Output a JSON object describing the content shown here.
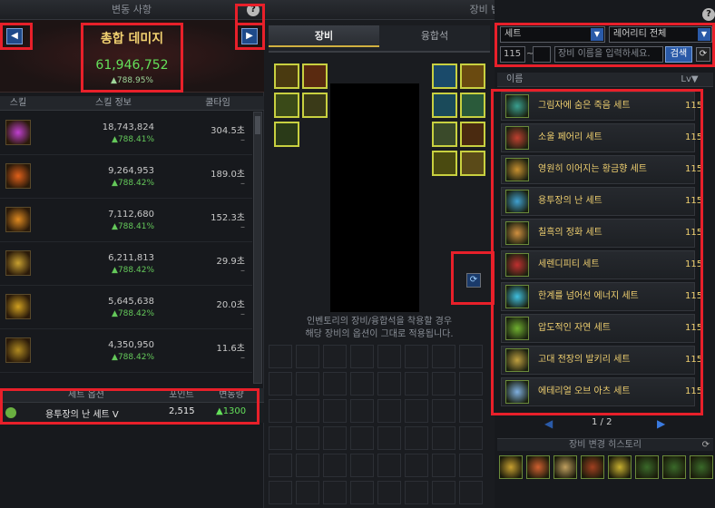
{
  "left_panel": {
    "title": "변동 사항",
    "prev_icon": "left-arrow-icon",
    "next_icon": "right-arrow-icon",
    "help_icon": "?",
    "total_damage": {
      "label": "총합 데미지",
      "value": "61,946,752",
      "change": "▲788.95%"
    },
    "columns": {
      "skill": "스킬",
      "info": "스킬 정보",
      "cooldown": "쿨타임"
    },
    "skills": [
      {
        "icon": "magic-burst-skill-icon",
        "color": "#c040d0",
        "value": "18,743,824",
        "change": "▲788.41%",
        "cooldown": "304.5초",
        "extra": "–"
      },
      {
        "icon": "atom-skill-icon",
        "color": "#e0601a",
        "value": "9,264,953",
        "change": "▲788.42%",
        "cooldown": "189.0초",
        "extra": "–"
      },
      {
        "icon": "fire-pillar-skill-icon",
        "color": "#e08a20",
        "value": "7,112,680",
        "change": "▲788.41%",
        "cooldown": "152.3초",
        "extra": "–"
      },
      {
        "icon": "golden-chest-skill-icon",
        "color": "#c8a030",
        "value": "6,211,813",
        "change": "▲788.42%",
        "cooldown": "29.9초",
        "extra": "–"
      },
      {
        "icon": "golden-bell-skill-icon",
        "color": "#d0a020",
        "value": "5,645,638",
        "change": "▲788.42%",
        "cooldown": "20.0초",
        "extra": "–"
      },
      {
        "icon": "golden-cannon-skill-icon",
        "color": "#b08a20",
        "value": "4,350,950",
        "change": "▲788.42%",
        "cooldown": "11.6초",
        "extra": "–"
      }
    ],
    "set_columns": {
      "name": "세트 옵션",
      "points": "포인트",
      "change": "변동량"
    },
    "set_option": {
      "name": "용투장의 난 세트 V",
      "points": "2,515",
      "change": "▲1300"
    }
  },
  "mid_panel": {
    "title": "장비 변경",
    "tabs": [
      "장비",
      "융합석"
    ],
    "notice_line1": "인벤토리의 장비/융합석을 착용할 경우",
    "notice_line2": "해당 장비의 옵션이 그대로 적용됩니다."
  },
  "right_panel": {
    "help_icon": "?",
    "filter_type": "세트",
    "filter_rarity": "레어리티 전체",
    "level_min": "115",
    "level_sep": "~",
    "search_placeholder": "장비 이름을 입력하세요.",
    "search_button": "검색",
    "columns": {
      "name": "이름",
      "level": "Lv▼"
    },
    "sets": [
      {
        "name": "그림자에 숨은 죽음 세트",
        "lv": "115",
        "color": "#3aa090"
      },
      {
        "name": "소울 페어리 세트",
        "lv": "115",
        "color": "#c04030"
      },
      {
        "name": "영원히 이어지는 황금향 세트",
        "lv": "115",
        "color": "#c89030"
      },
      {
        "name": "용투장의 난 세트",
        "lv": "115",
        "color": "#40a0d0"
      },
      {
        "name": "칠흑의 정화 세트",
        "lv": "115",
        "color": "#d09040"
      },
      {
        "name": "세렌디피티 세트",
        "lv": "115",
        "color": "#c03030"
      },
      {
        "name": "한계를 넘어선 에너지 세트",
        "lv": "115",
        "color": "#40c0e0"
      },
      {
        "name": "압도적인 자연 세트",
        "lv": "115",
        "color": "#70b030"
      },
      {
        "name": "고대 전장의 발키리 세트",
        "lv": "115",
        "color": "#c0a040"
      },
      {
        "name": "에테리얼 오브 아츠 세트",
        "lv": "115",
        "color": "#80b0e0"
      }
    ],
    "pager": {
      "prev": "◀",
      "text": "1 / 2",
      "next": "▶"
    },
    "history_title": "장비 변경 히스토리"
  }
}
